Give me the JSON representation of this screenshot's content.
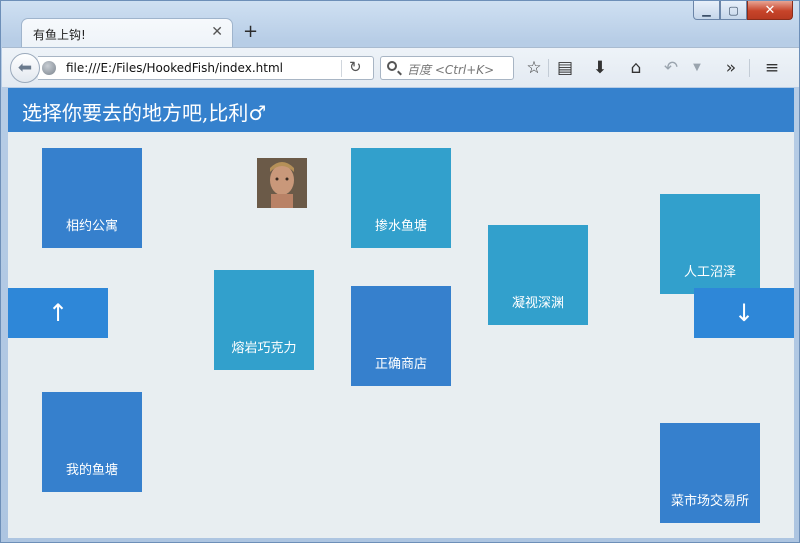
{
  "browser": {
    "tab_title": "有鱼上钩!",
    "tab_close": "✕",
    "new_tab": "+",
    "url": "file:///E:/Files/HookedFish/index.html",
    "search_placeholder": "百度 <Ctrl+K>",
    "window_controls": {
      "minimize": "▁",
      "maximize": "▢",
      "close": "✕"
    }
  },
  "page": {
    "title": "选择你要去的地方吧,比利♂",
    "tiles": [
      {
        "label": "相约公寓"
      },
      {
        "label": "掺水鱼塘"
      },
      {
        "label": "人工沼泽"
      },
      {
        "label": "熔岩巧克力"
      },
      {
        "label": "凝视深渊"
      },
      {
        "label": "正确商店"
      },
      {
        "label": "我的鱼塘"
      },
      {
        "label": "菜市场交易所"
      }
    ],
    "scroll_up": "↑",
    "scroll_down": "↓"
  },
  "colors": {
    "header": "#3581cd",
    "tile_blue": "#3680cd",
    "tile_teal": "#32a0cc",
    "arrow": "#2e87d8",
    "background": "#e8eef1"
  }
}
